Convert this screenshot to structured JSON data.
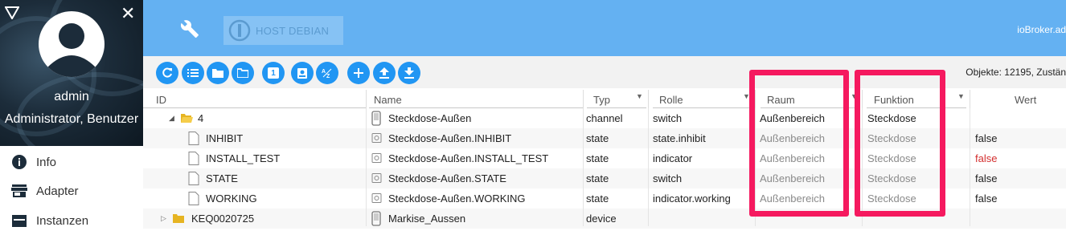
{
  "sidebar": {
    "user_name": "admin",
    "user_role": "Administrator, Benutzer",
    "close_glyph": "✕",
    "items": [
      {
        "label": "Info",
        "icon": "info-icon"
      },
      {
        "label": "Adapter",
        "icon": "store-icon"
      },
      {
        "label": "Instanzen",
        "icon": "instances-icon"
      }
    ]
  },
  "header": {
    "host_label": "HOST DEBIAN",
    "brand": "ioBroker.ad"
  },
  "toolbar": {
    "buttons": [
      "refresh-icon",
      "list-icon",
      "folder-icon",
      "folder-open-icon",
      "number-icon",
      "role-icon",
      "sort-az-icon",
      "add-icon",
      "upload-icon",
      "download-icon"
    ],
    "number_glyph": "1",
    "objects_count": "Objekte: 12195, Zustän"
  },
  "table": {
    "columns": {
      "id": "ID",
      "name": "Name",
      "type": "Typ",
      "role": "Rolle",
      "room": "Raum",
      "function": "Funktion",
      "value": "Wert"
    },
    "rows": [
      {
        "id": "4",
        "expand": "◢",
        "name": "Steckdose-Außen",
        "type": "channel",
        "role": "switch",
        "room": "Außenbereich",
        "function": "Steckdose",
        "value": ""
      },
      {
        "id": "INHIBIT",
        "name": "Steckdose-Außen.INHIBIT",
        "type": "state",
        "role": "state.inhibit",
        "room": "Außenbereich",
        "function": "Steckdose",
        "value": "false"
      },
      {
        "id": "INSTALL_TEST",
        "name": "Steckdose-Außen.INSTALL_TEST",
        "type": "state",
        "role": "indicator",
        "room": "Außenbereich",
        "function": "Steckdose",
        "value": "false"
      },
      {
        "id": "STATE",
        "name": "Steckdose-Außen.STATE",
        "type": "state",
        "role": "switch",
        "room": "Außenbereich",
        "function": "Steckdose",
        "value": "false"
      },
      {
        "id": "WORKING",
        "name": "Steckdose-Außen.WORKING",
        "type": "state",
        "role": "indicator.working",
        "room": "Außenbereich",
        "function": "Steckdose",
        "value": "false"
      },
      {
        "id": "KEQ0020725",
        "expand": "▷",
        "name": "Markise_Aussen",
        "type": "device",
        "role": "",
        "room": "",
        "function": "",
        "value": ""
      }
    ]
  },
  "colors": {
    "header": "#64b1f2",
    "button": "#2196f3",
    "highlight": "#f5195f",
    "value_false_red": "#d32f2f"
  }
}
